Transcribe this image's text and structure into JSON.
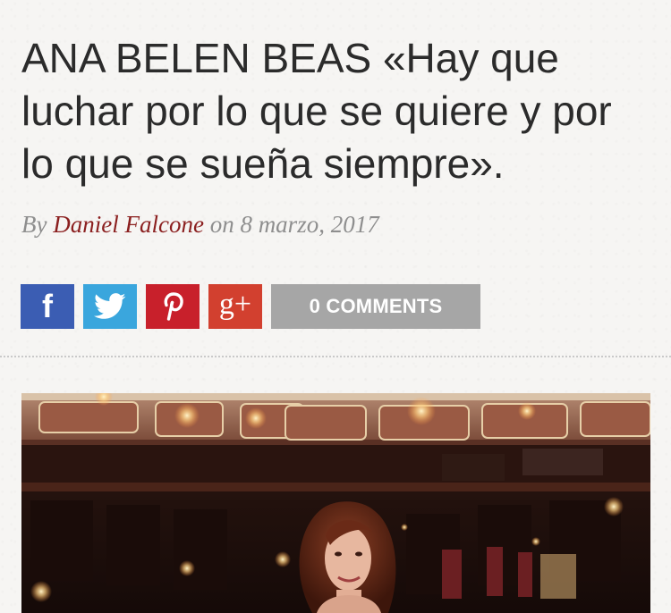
{
  "article": {
    "title": "ANA BELEN BEAS «Hay que luchar por lo que se quiere y por lo que se sueña siempre».",
    "byline": {
      "prefix": "By",
      "author": "Daniel Falcone",
      "on": "on",
      "date": "8 marzo, 2017"
    }
  },
  "share": {
    "facebook_glyph": "f",
    "googleplus_glyph": "g+",
    "comments_label": "0 COMMENTS",
    "icons": [
      "facebook-icon",
      "twitter-icon",
      "pinterest-icon",
      "google-plus-icon"
    ],
    "colors": {
      "facebook": "#3b5db3",
      "twitter": "#3aa6dd",
      "pinterest": "#c8202b",
      "googleplus": "#d2402f",
      "comments": "#a6a6a6"
    }
  },
  "colors": {
    "author_link": "#8b1f1f",
    "title_text": "#2b2b2b",
    "byline_text": "#8e8e8e"
  }
}
